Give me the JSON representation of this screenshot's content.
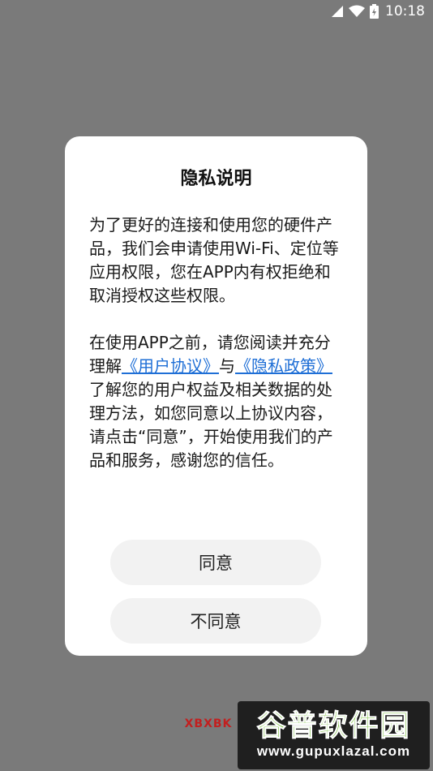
{
  "status_bar": {
    "time": "10:18",
    "icons": [
      "wifi-icon",
      "signal-icon",
      "battery-icon"
    ]
  },
  "dialog": {
    "title": "隐私说明",
    "paragraph1": "为了更好的连接和使用您的硬件产品，我们会申请使用Wi-Fi、定位等应用权限，您在APP内有权拒绝和取消授权这些权限。",
    "paragraph2": {
      "prefix": "在使用APP之前，请您阅读并充分理解",
      "link1": "《用户协议》",
      "middle": "与",
      "link2": "《隐私政策》",
      "suffix": "了解您的用户权益及相关数据的处理方法，如您同意以上协议内容，请点击“同意”，开始使用我们的产品和服务，感谢您的信任。"
    },
    "agree_label": "同意",
    "disagree_label": "不同意"
  },
  "watermark": {
    "logo_text": "XBXBK",
    "title": "谷普软件园",
    "url": "www.gupuxlazal.com"
  },
  "colors": {
    "overlay": "#7a7a7a",
    "dialog_bg": "#ffffff",
    "link": "#1f6fd6",
    "button_bg": "#f2f2f2"
  }
}
